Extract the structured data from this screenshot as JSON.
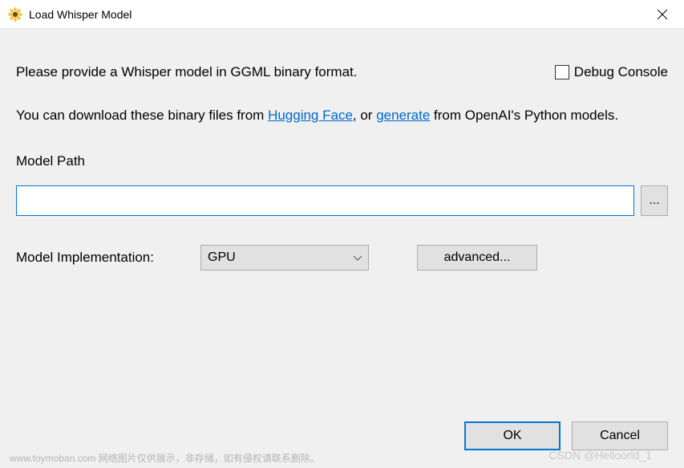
{
  "window": {
    "title": "Load Whisper Model"
  },
  "instruction": "Please provide a Whisper model in GGML binary format.",
  "debug_console_label": "Debug Console",
  "download": {
    "prefix": "You can download these binary files from ",
    "link1": "Hugging Face",
    "mid": ", or ",
    "link2": "generate",
    "suffix": " from OpenAI's Python models."
  },
  "model_path": {
    "label": "Model Path",
    "value": "",
    "browse": "..."
  },
  "implementation": {
    "label": "Model Implementation:",
    "selected": "GPU",
    "advanced": "advanced..."
  },
  "buttons": {
    "ok": "OK",
    "cancel": "Cancel"
  },
  "watermarks": {
    "left": "www.toymoban.com  网络图片仅供展示，非存储，如有侵权请联系删除。",
    "right": "CSDN @Helloorld_1"
  }
}
